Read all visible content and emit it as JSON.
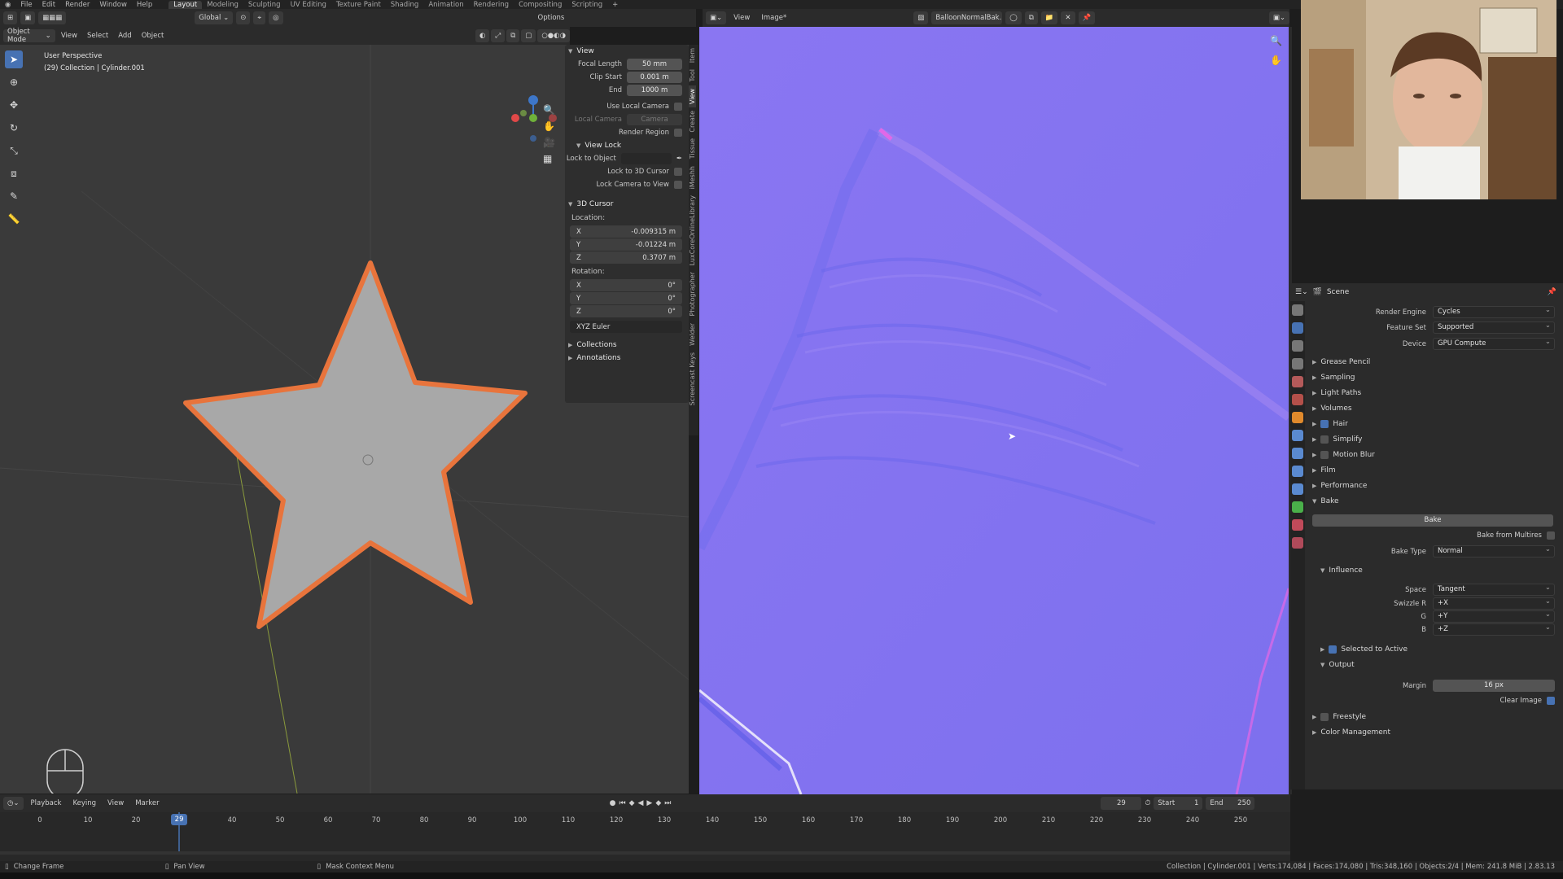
{
  "top_menu": [
    "File",
    "Edit",
    "Render",
    "Window",
    "Help"
  ],
  "workspaces": [
    "Layout",
    "Modeling",
    "Sculpting",
    "UV Editing",
    "Texture Paint",
    "Shading",
    "Animation",
    "Rendering",
    "Compositing",
    "Scripting"
  ],
  "add_workspace": "+",
  "viewport": {
    "mode": "Object Mode",
    "menus": [
      "View",
      "Select",
      "Add",
      "Object"
    ],
    "orientation": "Global",
    "options": "Options",
    "info_line1": "User Perspective",
    "info_line2": "(29) Collection | Cylinder.001"
  },
  "npanel": {
    "view_title": "View",
    "focal_label": "Focal Length",
    "focal_value": "50 mm",
    "clip_start_label": "Clip Start",
    "clip_start_value": "0.001 m",
    "end_label": "End",
    "end_value": "1000 m",
    "use_local_camera": "Use Local Camera",
    "local_camera_label": "Local Camera",
    "local_camera_value": "Camera",
    "render_region": "Render Region",
    "view_lock": "View Lock",
    "lock_to_object": "Lock to Object",
    "lock_to_3d_cursor": "Lock to 3D Cursor",
    "lock_camera_to_view": "Lock Camera to View",
    "cursor_title": "3D Cursor",
    "location_label": "Location:",
    "loc_x_label": "X",
    "loc_x": "-0.009315 m",
    "loc_y_label": "Y",
    "loc_y": "-0.01224 m",
    "loc_z_label": "Z",
    "loc_z": "0.3707 m",
    "rotation_label": "Rotation:",
    "rot_x": "0°",
    "rot_y": "0°",
    "rot_z": "0°",
    "rotation_mode": "XYZ Euler",
    "collections": "Collections",
    "annotations": "Annotations",
    "tabs": [
      "Item",
      "Tool",
      "View",
      "Create",
      "Tissue",
      "iMeshh",
      "LuxCoreOnlineLibrary",
      "Photographer",
      "Welder",
      "Screencast Keys"
    ]
  },
  "image_editor": {
    "menus": [
      "View",
      "Image*"
    ],
    "image_name": "BalloonNormalBak..."
  },
  "properties": {
    "scene": "Scene",
    "render_engine_label": "Render Engine",
    "render_engine": "Cycles",
    "feature_set_label": "Feature Set",
    "feature_set": "Supported",
    "device_label": "Device",
    "device": "GPU Compute",
    "sections": [
      "Grease Pencil",
      "Sampling",
      "Light Paths",
      "Volumes",
      "Hair",
      "Simplify",
      "Motion Blur",
      "Film",
      "Performance",
      "Bake"
    ],
    "bake_button": "Bake",
    "bake_from_multires": "Bake from Multires",
    "bake_type_label": "Bake Type",
    "bake_type": "Normal",
    "influence": "Influence",
    "space_label": "Space",
    "space": "Tangent",
    "swizzle_r_label": "Swizzle R",
    "swizzle_r": "+X",
    "swizzle_g_label": "G",
    "swizzle_g": "+Y",
    "swizzle_b_label": "B",
    "swizzle_b": "+Z",
    "selected_to_active": "Selected to Active",
    "output": "Output",
    "margin_label": "Margin",
    "margin": "16 px",
    "clear_image": "Clear Image",
    "freestyle": "Freestyle",
    "color_management": "Color Management"
  },
  "timeline": {
    "menus": [
      "Playback",
      "Keying",
      "View",
      "Marker"
    ],
    "current_frame": "29",
    "start_label": "Start",
    "start": "1",
    "end_label": "End",
    "end": "250",
    "ticks": [
      "0",
      "10",
      "20",
      "29",
      "40",
      "50",
      "60",
      "70",
      "80",
      "90",
      "100",
      "110",
      "120",
      "130",
      "140",
      "150",
      "160",
      "170",
      "180",
      "190",
      "200",
      "210",
      "220",
      "230",
      "240",
      "250"
    ]
  },
  "status": {
    "change_frame": "Change Frame",
    "pan_view": "Pan View",
    "context_menu": "Mask Context Menu",
    "stats": "Collection | Cylinder.001 | Verts:174,084 | Faces:174,080 | Tris:348,160 | Objects:2/4 | Mem: 241.8 MiB | 2.83.13"
  },
  "colors": {
    "accent": "#4772b3",
    "orange_select": "#e8743c",
    "normal_map_base": "#8274f0"
  }
}
